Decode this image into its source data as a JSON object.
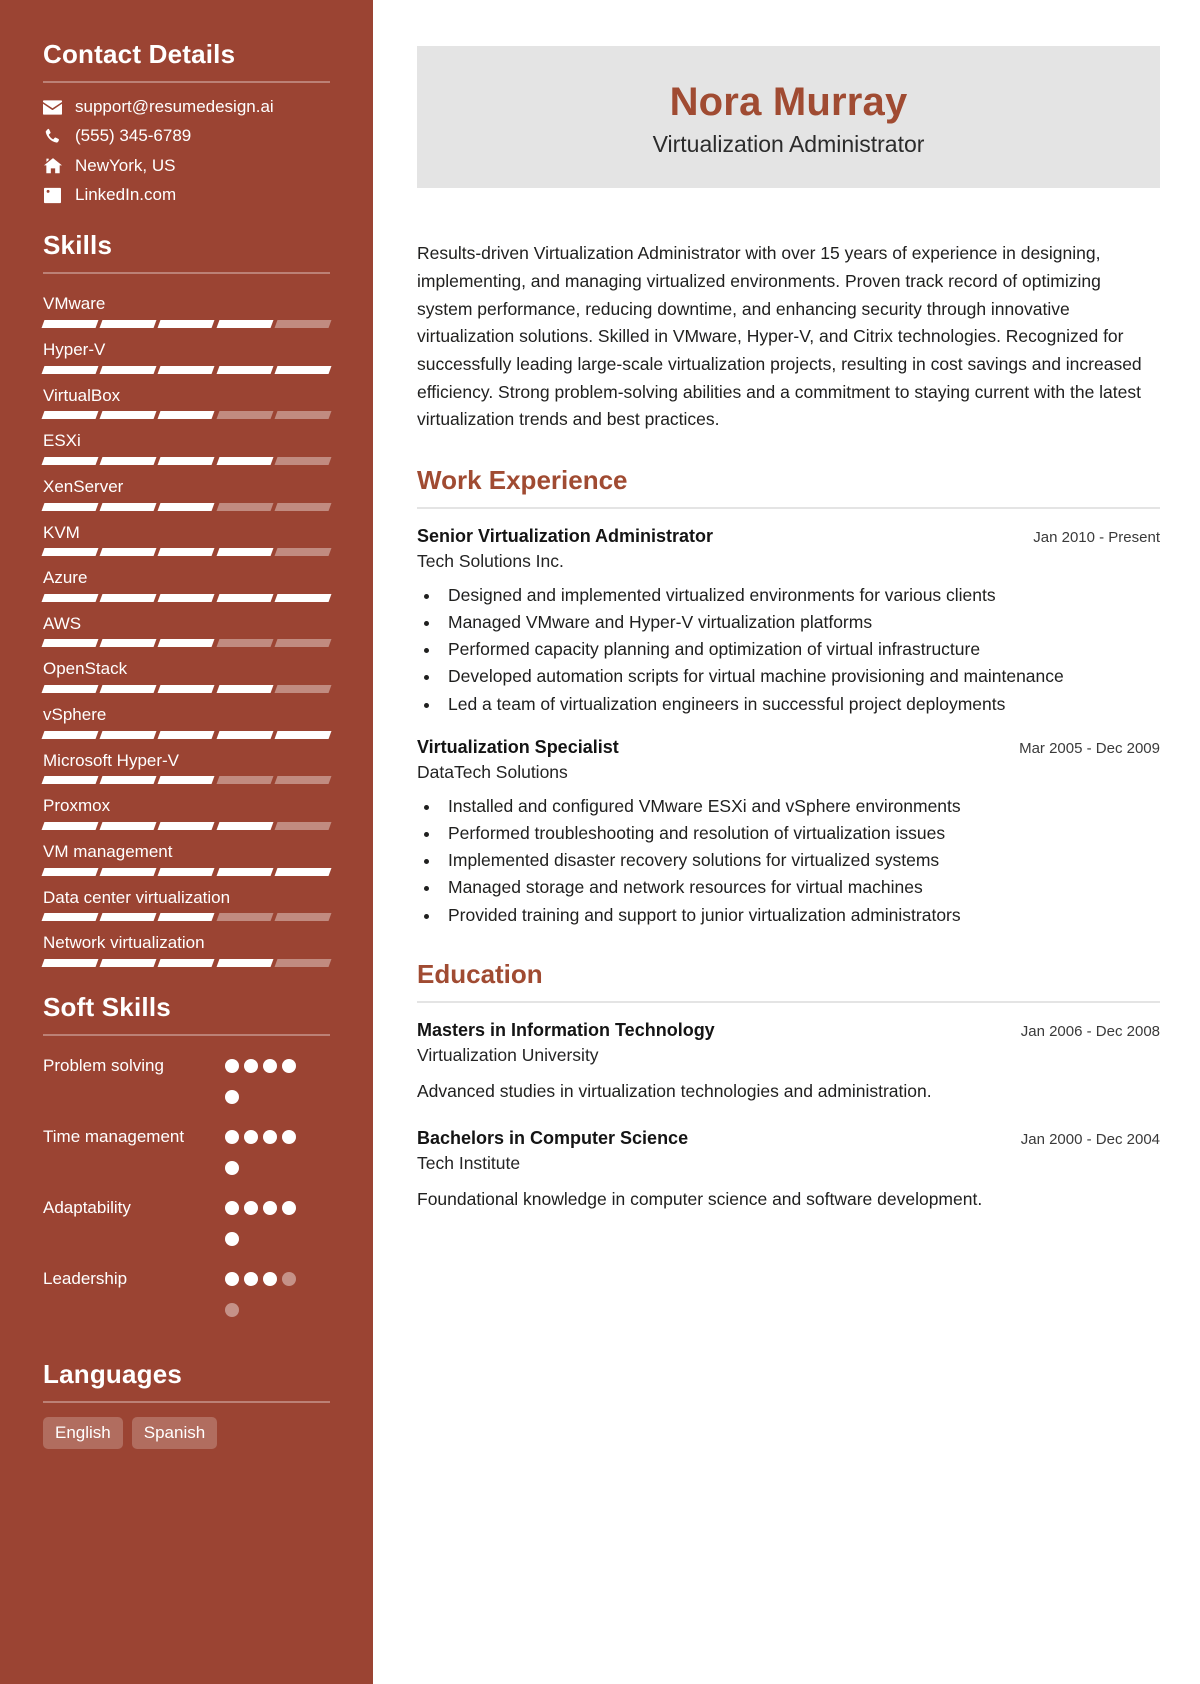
{
  "colors": {
    "sidebar_bg": "#9B4433",
    "accent": "#A04B32",
    "band_bg": "#E4E4E4",
    "text": "#20201F"
  },
  "header": {
    "name": "Nora Murray",
    "title": "Virtualization Administrator"
  },
  "summary": "Results-driven Virtualization Administrator with over 15 years of experience in designing, implementing, and managing virtualized environments. Proven track record of optimizing system performance, reducing downtime, and enhancing security through innovative virtualization solutions. Skilled in VMware, Hyper-V, and Citrix technologies. Recognized for successfully leading large-scale virtualization projects, resulting in cost savings and increased efficiency. Strong problem-solving abilities and a commitment to staying current with the latest virtualization trends and best practices.",
  "sidebar": {
    "contact": {
      "heading": "Contact Details",
      "items": [
        {
          "icon": "envelope-icon",
          "value": "support@resumedesign.ai"
        },
        {
          "icon": "phone-icon",
          "value": "(555) 345-6789"
        },
        {
          "icon": "home-icon",
          "value": "NewYork, US"
        },
        {
          "icon": "linkedin-icon",
          "value": "LinkedIn.com"
        }
      ]
    },
    "skills": {
      "heading": "Skills",
      "max_level": 5,
      "items": [
        {
          "name": "VMware",
          "level": 4
        },
        {
          "name": "Hyper-V",
          "level": 5
        },
        {
          "name": "VirtualBox",
          "level": 3
        },
        {
          "name": "ESXi",
          "level": 4
        },
        {
          "name": "XenServer",
          "level": 3
        },
        {
          "name": "KVM",
          "level": 4
        },
        {
          "name": "Azure",
          "level": 5
        },
        {
          "name": "AWS",
          "level": 3
        },
        {
          "name": "OpenStack",
          "level": 4
        },
        {
          "name": "vSphere",
          "level": 5
        },
        {
          "name": "Microsoft Hyper-V",
          "level": 3
        },
        {
          "name": "Proxmox",
          "level": 4
        },
        {
          "name": "VM management",
          "level": 5
        },
        {
          "name": "Data center virtualization",
          "level": 3
        },
        {
          "name": "Network virtualization",
          "level": 4
        }
      ]
    },
    "soft_skills": {
      "heading": "Soft Skills",
      "max_level": 5,
      "items": [
        {
          "name": "Problem solving",
          "level": 5
        },
        {
          "name": "Time management",
          "level": 5
        },
        {
          "name": "Adaptability",
          "level": 5
        },
        {
          "name": "Leadership",
          "level": 3
        }
      ]
    },
    "languages": {
      "heading": "Languages",
      "items": [
        "English",
        "Spanish"
      ]
    }
  },
  "main": {
    "work": {
      "heading": "Work Experience",
      "entries": [
        {
          "title": "Senior Virtualization Administrator",
          "date": "Jan 2010 - Present",
          "org": "Tech Solutions Inc.",
          "bullets": [
            "Designed and implemented virtualized environments for various clients",
            "Managed VMware and Hyper-V virtualization platforms",
            "Performed capacity planning and optimization of virtual infrastructure",
            "Developed automation scripts for virtual machine provisioning and maintenance",
            "Led a team of virtualization engineers in successful project deployments"
          ]
        },
        {
          "title": "Virtualization Specialist",
          "date": "Mar 2005 - Dec 2009",
          "org": "DataTech Solutions",
          "bullets": [
            "Installed and configured VMware ESXi and vSphere environments",
            "Performed troubleshooting and resolution of virtualization issues",
            "Implemented disaster recovery solutions for virtualized systems",
            "Managed storage and network resources for virtual machines",
            "Provided training and support to junior virtualization administrators"
          ]
        }
      ]
    },
    "education": {
      "heading": "Education",
      "entries": [
        {
          "title": "Masters in Information Technology",
          "date": "Jan 2006 - Dec 2008",
          "org": "Virtualization University",
          "desc": "Advanced studies in virtualization technologies and administration."
        },
        {
          "title": "Bachelors in Computer Science",
          "date": "Jan 2000 - Dec 2004",
          "org": "Tech Institute",
          "desc": "Foundational knowledge in computer science and software development."
        }
      ]
    }
  }
}
